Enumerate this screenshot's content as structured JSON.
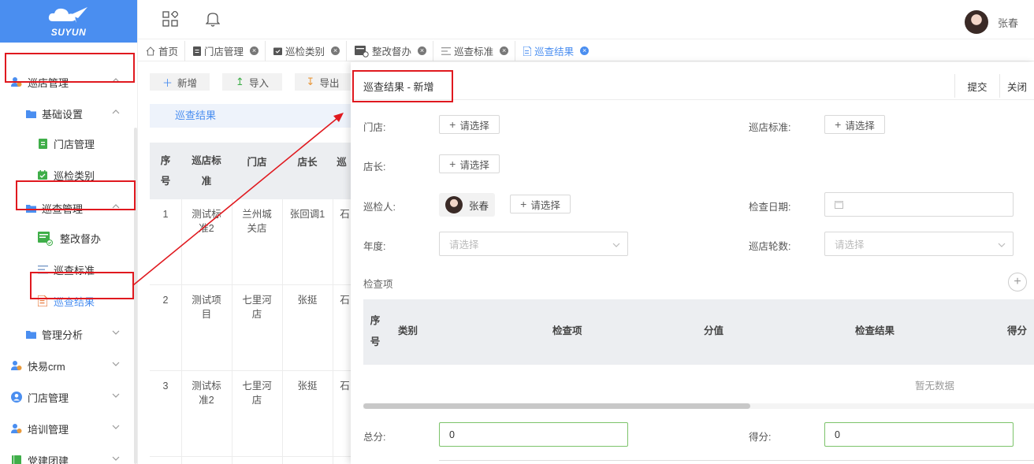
{
  "app": {
    "logo_text": "SUYUN",
    "user_name": "张春"
  },
  "sidebar": {
    "items": [
      {
        "label": "巡店管理",
        "level": 1,
        "icon": "user-group-icon",
        "expanded": true
      },
      {
        "label": "基础设置",
        "level": 2,
        "icon": "folder-icon",
        "expanded": true
      },
      {
        "label": "门店管理",
        "level": 3,
        "icon": "green-doc-icon"
      },
      {
        "label": "巡检类别",
        "level": 3,
        "icon": "green-calendar-icon"
      },
      {
        "label": "巡查管理",
        "level": 2,
        "icon": "folder-icon",
        "expanded": true
      },
      {
        "label": "整改督办",
        "level": 3,
        "icon": "green-monitor-icon"
      },
      {
        "label": "巡查标准",
        "level": 3,
        "icon": "list-icon"
      },
      {
        "label": "巡查结果",
        "level": 3,
        "icon": "orange-doc-icon",
        "active": true
      },
      {
        "label": "管理分析",
        "level": 2,
        "icon": "folder-icon",
        "expanded": false
      },
      {
        "label": "快易crm",
        "level": 1,
        "icon": "user-group-icon",
        "expanded": false
      },
      {
        "label": "门店管理",
        "level": 1,
        "icon": "person-circle-icon",
        "expanded": false
      },
      {
        "label": "培训管理",
        "level": 1,
        "icon": "user-group-icon",
        "expanded": false
      },
      {
        "label": "党建团建",
        "level": 1,
        "icon": "green-book-icon",
        "expanded": false
      }
    ]
  },
  "tabs": [
    {
      "label": "首页",
      "icon": "home-icon",
      "closable": false
    },
    {
      "label": "门店管理",
      "icon": "doc-icon",
      "closable": true
    },
    {
      "label": "巡检类别",
      "icon": "calendar-icon",
      "closable": true
    },
    {
      "label": "整改督办",
      "icon": "monitor-icon",
      "closable": true
    },
    {
      "label": "巡查标准",
      "icon": "list-icon",
      "closable": true
    },
    {
      "label": "巡查结果",
      "icon": "doc-icon",
      "closable": true,
      "active": true
    }
  ],
  "list_page": {
    "toolbar": {
      "add": "新增",
      "import": "导入",
      "export": "导出"
    },
    "section_title": "巡查结果",
    "headers": {
      "seq_a": "序",
      "seq_b": "号",
      "std_a": "巡店标",
      "std_b": "准",
      "store": "门店",
      "manager": "店长",
      "next": "巡"
    },
    "rows": [
      {
        "seq": "1",
        "std": "测试标准2",
        "store": "兰州城关店",
        "manager": "张回调1",
        "next": "石"
      },
      {
        "seq": "2",
        "std": "测试项目",
        "store": "七里河店",
        "manager": "张挺",
        "next": "石"
      },
      {
        "seq": "3",
        "std": "测试标准2",
        "store": "七里河店",
        "manager": "张挺",
        "next": "石"
      }
    ]
  },
  "panel": {
    "title": "巡查结果 - 新增",
    "submit": "提交",
    "close": "关闭",
    "form": {
      "store_label": "门店:",
      "store_select": "请选择",
      "standard_label": "巡店标准:",
      "standard_select": "请选择",
      "manager_label": "店长:",
      "manager_select": "请选择",
      "inspector_label": "巡检人:",
      "inspector_name": "张春",
      "inspector_select": "请选择",
      "date_label": "检查日期:",
      "year_label": "年度:",
      "year_placeholder": "请选择",
      "rounds_label": "巡店轮数:",
      "rounds_placeholder": "请选择",
      "items_label": "检查项",
      "total_label": "总分:",
      "total_value": "0",
      "score_label": "得分:",
      "score_value": "0"
    },
    "table": {
      "headers": {
        "seq_a": "序",
        "seq_b": "号",
        "category": "类别",
        "item": "检查项",
        "points": "分值",
        "result": "检查结果",
        "score": "得分"
      },
      "empty_text": "暂无数据"
    }
  },
  "colors": {
    "accent": "#4a8ef0",
    "annotation": "#e0191f",
    "valid_border": "#7cc36a"
  }
}
